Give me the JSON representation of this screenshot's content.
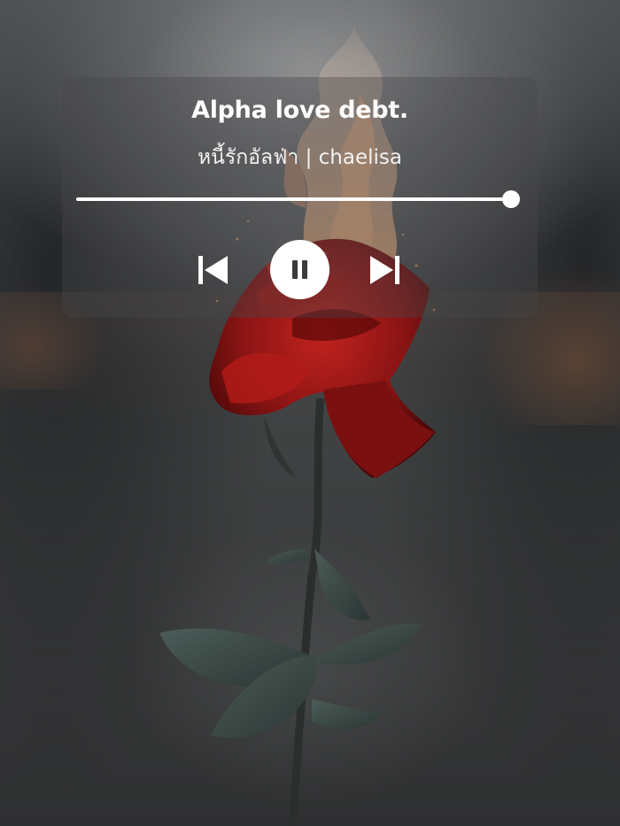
{
  "player": {
    "title": "Alpha love debt.",
    "artist_line": "หนี้รักอัลฟ่า | chaelisa",
    "progress_fraction": 0.99,
    "is_playing": true,
    "controls": {
      "previous_icon": "skip-previous-icon",
      "pause_icon": "pause-icon",
      "next_icon": "skip-next-icon"
    }
  },
  "colors": {
    "text": "#ffffff",
    "card_background": "rgba(70,72,74,0.38)",
    "rose": "#8e1414",
    "flame": "#f3a36a",
    "leaf": "#3c4a47"
  }
}
